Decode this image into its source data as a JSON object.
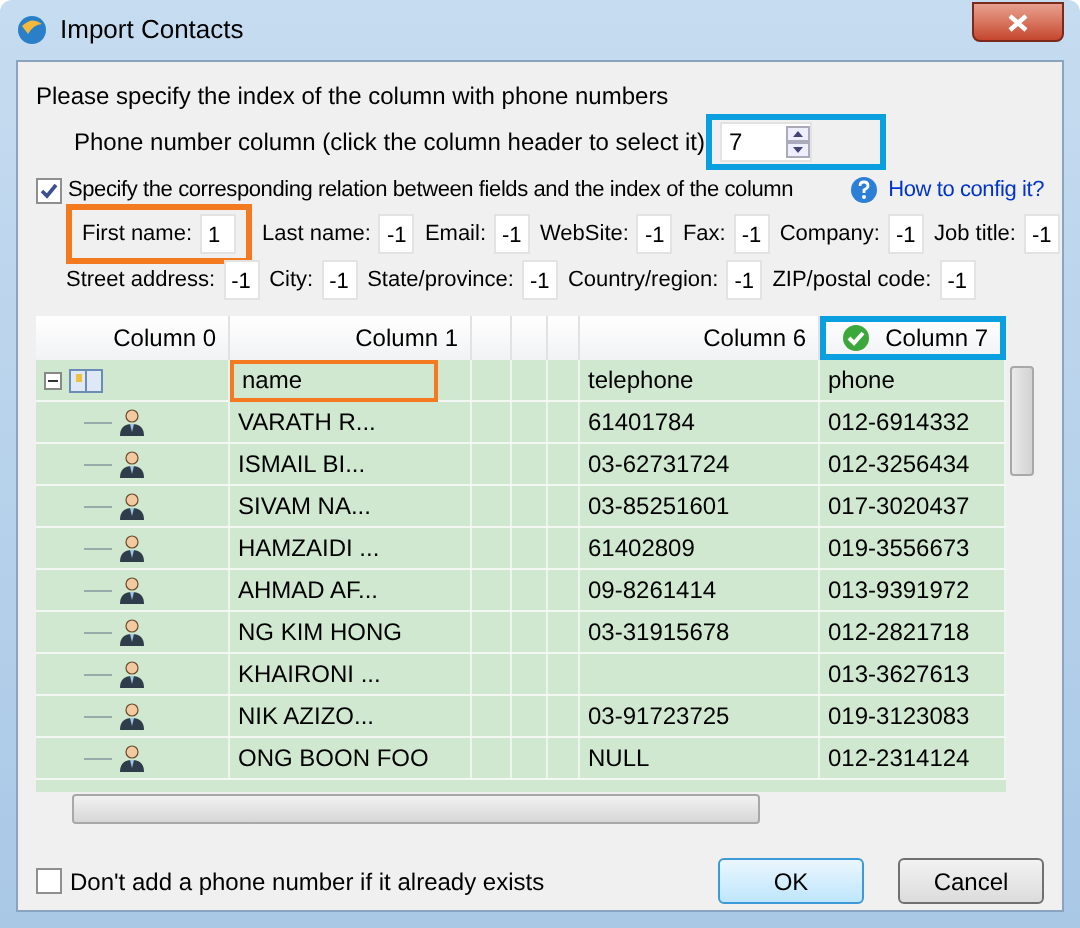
{
  "window": {
    "title": "Import Contacts"
  },
  "instruction": "Please specify the index of the column with phone numbers",
  "phone_column": {
    "label": "Phone number column (click the column header to select it)",
    "value": "7",
    "highlighted": true
  },
  "relation": {
    "label": "Specify the corresponding relation between fields and the index of the column",
    "checked": true
  },
  "help_link": "How to config it?",
  "field_rows": [
    [
      {
        "label": "First name:",
        "value": "1",
        "highlighted": true
      },
      {
        "label": "Last name:",
        "value": "-1",
        "highlighted": false
      },
      {
        "label": "Email:",
        "value": "-1",
        "highlighted": false
      },
      {
        "label": "WebSite:",
        "value": "-1",
        "highlighted": false
      },
      {
        "label": "Fax:",
        "value": "-1",
        "highlighted": false
      },
      {
        "label": "Company:",
        "value": "-1",
        "highlighted": false
      },
      {
        "label": "Job title:",
        "value": "-1",
        "highlighted": false
      }
    ],
    [
      {
        "label": "Street address:",
        "value": "-1",
        "highlighted": false
      },
      {
        "label": "City:",
        "value": "-1",
        "highlighted": false
      },
      {
        "label": "State/province:",
        "value": "-1",
        "highlighted": false
      },
      {
        "label": "Country/region:",
        "value": "-1",
        "highlighted": false
      },
      {
        "label": "ZIP/postal code:",
        "value": "-1",
        "highlighted": false
      }
    ]
  ],
  "table": {
    "columns": [
      {
        "kind": "label",
        "label": "Column 0",
        "selected": false,
        "highlighted": false
      },
      {
        "kind": "label",
        "label": "Column 1",
        "selected": false,
        "highlighted": false
      },
      {
        "kind": "blank",
        "selected": false,
        "highlighted": false
      },
      {
        "kind": "blank",
        "selected": false,
        "highlighted": false
      },
      {
        "kind": "blank",
        "selected": false,
        "highlighted": false
      },
      {
        "kind": "label",
        "label": "Column 6",
        "selected": false,
        "highlighted": false
      },
      {
        "kind": "label",
        "label": "Column 7",
        "selected": true,
        "highlighted": true
      }
    ],
    "rows": [
      {
        "kind": "group",
        "expanded": true,
        "highlighted": true,
        "cells": [
          "name",
          "telephone",
          "phone"
        ]
      },
      {
        "kind": "contact",
        "highlighted": false,
        "cells": [
          "VARATH R...",
          "61401784",
          "012-6914332"
        ]
      },
      {
        "kind": "contact",
        "highlighted": false,
        "cells": [
          "ISMAIL BI...",
          "03-62731724",
          "012-3256434"
        ]
      },
      {
        "kind": "contact",
        "highlighted": false,
        "cells": [
          "SIVAM NA...",
          "03-85251601",
          "017-3020437"
        ]
      },
      {
        "kind": "contact",
        "highlighted": false,
        "cells": [
          "HAMZAIDI ...",
          "61402809",
          "019-3556673"
        ]
      },
      {
        "kind": "contact",
        "highlighted": false,
        "cells": [
          "AHMAD AF...",
          "09-8261414",
          "013-9391972"
        ]
      },
      {
        "kind": "contact",
        "highlighted": false,
        "cells": [
          "NG KIM HONG",
          "03-31915678",
          "012-2821718"
        ]
      },
      {
        "kind": "contact",
        "highlighted": false,
        "cells": [
          "KHAIRONI ...",
          null,
          "013-3627613"
        ]
      },
      {
        "kind": "contact",
        "highlighted": false,
        "cells": [
          "NIK AZIZO...",
          "03-91723725",
          "019-3123083"
        ]
      },
      {
        "kind": "contact",
        "highlighted": false,
        "cells": [
          "ONG BOON FOO",
          "NULL",
          "012-2314124"
        ]
      }
    ]
  },
  "skip_existing": {
    "label": "Don't add a phone number if it already exists",
    "checked": false
  },
  "buttons": [
    {
      "label": "OK",
      "default": true
    },
    {
      "label": "Cancel",
      "default": false
    }
  ]
}
